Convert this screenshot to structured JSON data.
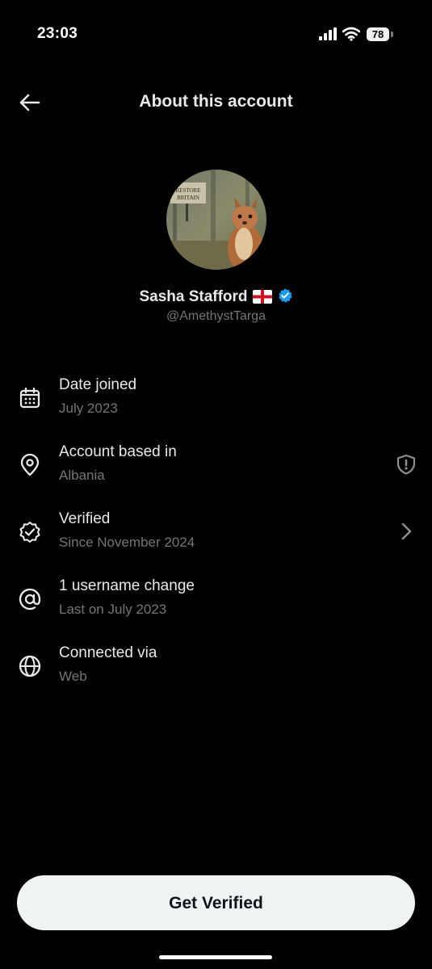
{
  "status_bar": {
    "time": "23:03",
    "battery": "78"
  },
  "header": {
    "title": "About this account",
    "back_icon": "arrow-left-icon"
  },
  "profile": {
    "name": "Sasha Stafford",
    "handle": "@AmethystTarga",
    "flag_icon": "england-flag-icon",
    "verified_icon": "verified-badge-icon",
    "verified_color": "#1d9bf0",
    "avatar_sign_text": [
      "RESTORE",
      "BRITAIN"
    ]
  },
  "details": [
    {
      "icon": "calendar-icon",
      "label": "Date joined",
      "value": "July 2023"
    },
    {
      "icon": "location-pin-icon",
      "label": "Account based in",
      "value": "Albania",
      "trailing_icon": "shield-alert-icon"
    },
    {
      "icon": "verified-check-icon",
      "label": "Verified",
      "value": "Since November 2024",
      "trailing_icon": "chevron-right-icon"
    },
    {
      "icon": "at-sign-icon",
      "label": "1 username change",
      "value": "Last on July 2023"
    },
    {
      "icon": "globe-icon",
      "label": "Connected via",
      "value": "Web"
    }
  ],
  "cta": {
    "label": "Get Verified"
  },
  "colors": {
    "background": "#000000",
    "primary_text": "#e7e9ea",
    "secondary_text": "#71767b",
    "button_bg": "#eff3f4"
  }
}
